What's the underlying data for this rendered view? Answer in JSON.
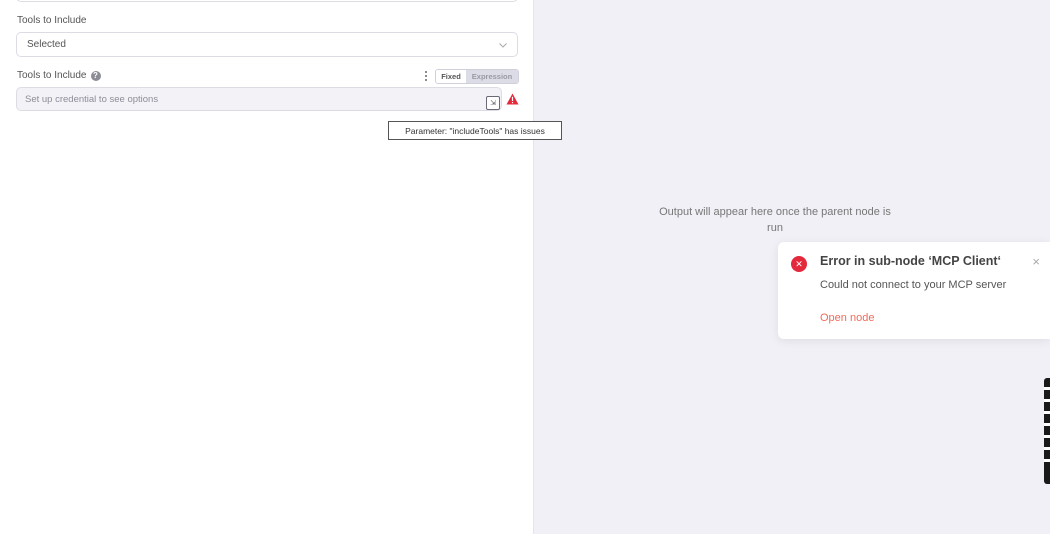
{
  "params": {
    "tools_label": "Tools to Include",
    "tools_selected": "Selected",
    "tools_list_label": "Tools to Include",
    "toggle_fixed": "Fixed",
    "toggle_expression": "Expression",
    "credential_placeholder": "Set up credential to see options",
    "tooltip": "Parameter: \"includeTools\" has issues"
  },
  "output": {
    "message": "Output will appear here once the parent node is run"
  },
  "toast": {
    "title": "Error in sub-node ‘MCP Client‘",
    "message": "Could not connect to your MCP server",
    "link": "Open node",
    "close": "×"
  },
  "colors": {
    "error": "#e5293d",
    "link": "#ef6b5a",
    "panel_bg": "#f0f0f6"
  },
  "icons": [
    "chevron-down-icon",
    "help-icon",
    "kebab-menu-icon",
    "expand-icon",
    "warning-icon",
    "error-icon",
    "close-icon"
  ]
}
